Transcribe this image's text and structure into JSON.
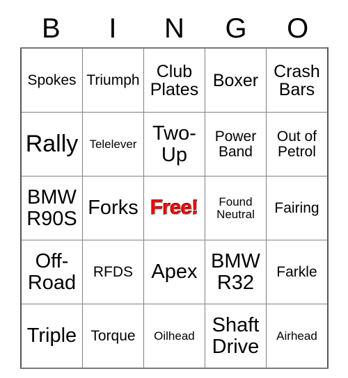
{
  "card": {
    "title": "BINGO",
    "header_letters": [
      "B",
      "I",
      "N",
      "G",
      "O"
    ],
    "grid_line_color": "#808080",
    "free_color": "#ff0000",
    "text_color": "#000000",
    "rows": [
      [
        {
          "label": "Spokes",
          "size": "sm",
          "free": false
        },
        {
          "label": "Triumph",
          "size": "sm",
          "free": false
        },
        {
          "label": "Club Plates",
          "size": "md",
          "free": false
        },
        {
          "label": "Boxer",
          "size": "md",
          "free": false
        },
        {
          "label": "Crash Bars",
          "size": "md",
          "free": false
        }
      ],
      [
        {
          "label": "Rally",
          "size": "xl",
          "free": false
        },
        {
          "label": "Telelever",
          "size": "xs",
          "free": false
        },
        {
          "label": "Two-Up",
          "size": "lg",
          "free": false
        },
        {
          "label": "Power Band",
          "size": "sm",
          "free": false
        },
        {
          "label": "Out of Petrol",
          "size": "sm",
          "free": false
        }
      ],
      [
        {
          "label": "BMW R90S",
          "size": "lg",
          "free": false
        },
        {
          "label": "Forks",
          "size": "lg",
          "free": false
        },
        {
          "label": "Free!",
          "size": "lg",
          "free": true
        },
        {
          "label": "Found Neutral",
          "size": "xs",
          "free": false
        },
        {
          "label": "Fairing",
          "size": "sm",
          "free": false
        }
      ],
      [
        {
          "label": "Off-Road",
          "size": "lg",
          "free": false
        },
        {
          "label": "RFDS",
          "size": "sm",
          "free": false
        },
        {
          "label": "Apex",
          "size": "lg",
          "free": false
        },
        {
          "label": "BMW R32",
          "size": "lg",
          "free": false
        },
        {
          "label": "Farkle",
          "size": "sm",
          "free": false
        }
      ],
      [
        {
          "label": "Triple",
          "size": "lg",
          "free": false
        },
        {
          "label": "Torque",
          "size": "sm",
          "free": false
        },
        {
          "label": "Oilhead",
          "size": "xs",
          "free": false
        },
        {
          "label": "Shaft Drive",
          "size": "lg",
          "free": false
        },
        {
          "label": "Airhead",
          "size": "xs",
          "free": false
        }
      ]
    ]
  }
}
